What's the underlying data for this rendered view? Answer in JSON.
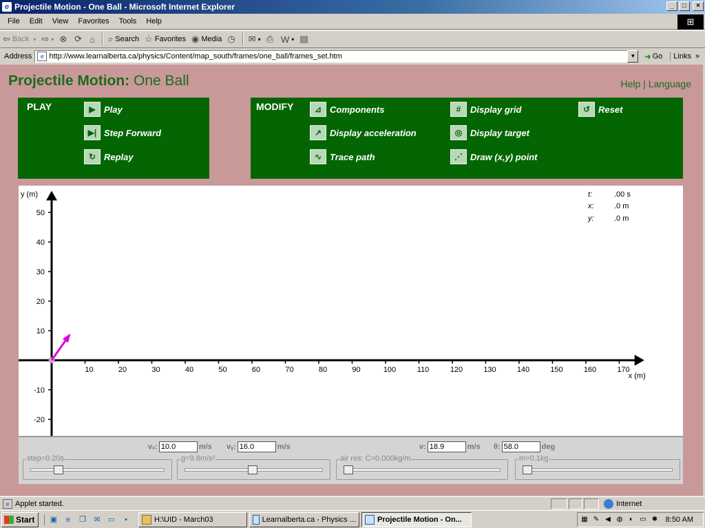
{
  "window": {
    "title": "Projectile Motion - One Ball - Microsoft Internet Explorer",
    "buttons": {
      "minimize": "_",
      "maximize": "□",
      "close": "×"
    }
  },
  "menu": [
    "File",
    "Edit",
    "View",
    "Favorites",
    "Tools",
    "Help"
  ],
  "toolbar": {
    "back": "Back",
    "search": "Search",
    "favorites": "Favorites",
    "media": "Media"
  },
  "address": {
    "label": "Address",
    "url": "http://www.learnalberta.ca/physics/Content/map_south/frames/one_ball/frames_set.htm",
    "go": "Go",
    "links": "Links"
  },
  "page": {
    "heading_bold": "Projectile Motion:",
    "heading_rest": " One Ball",
    "help": "Help",
    "separator": " | ",
    "language": "Language",
    "play_panel": {
      "title": "PLAY",
      "buttons": [
        {
          "label": "Play",
          "icon": "play-icon"
        },
        {
          "label": "Step Forward",
          "icon": "step-forward-icon"
        },
        {
          "label": "Replay",
          "icon": "replay-icon"
        }
      ]
    },
    "modify_panel": {
      "title": "MODIFY",
      "buttons": [
        {
          "label": "Components",
          "icon": "components-icon"
        },
        {
          "label": "Display acceleration",
          "icon": "acceleration-icon"
        },
        {
          "label": "Trace path",
          "icon": "trace-path-icon"
        },
        {
          "label": "Display grid",
          "icon": "grid-icon"
        },
        {
          "label": "Display target",
          "icon": "target-icon"
        },
        {
          "label": "Draw (x,y) point",
          "icon": "draw-point-icon"
        },
        {
          "label": "Reset",
          "icon": "reset-icon"
        }
      ]
    },
    "readout": [
      {
        "key": "t:",
        "value": ".00 s"
      },
      {
        "key": "x:",
        "value": ".0 m"
      },
      {
        "key": "y:",
        "value": ".0 m"
      }
    ],
    "controls": {
      "vx": {
        "label": "vₓ:",
        "value": "10.0",
        "unit": "m/s"
      },
      "vy": {
        "label": "vᵧ:",
        "value": "16.0",
        "unit": "m/s"
      },
      "v": {
        "label": "v:",
        "value": "18.9",
        "unit": "m/s"
      },
      "theta": {
        "label": "θ:",
        "value": "58.0",
        "unit": "deg"
      },
      "sliders": [
        {
          "title": "step=0.20s",
          "level": 0.19
        },
        {
          "title": "g=9.8m/s²",
          "level": 0.49
        },
        {
          "title": "air res: C=0.000kg/m",
          "level": 0.0
        },
        {
          "title": "m=0.1kg",
          "level": 0.0
        }
      ]
    }
  },
  "chart_data": {
    "type": "scatter",
    "xlabel": "x (m)",
    "ylabel": "y (m)",
    "xlim": [
      0,
      175
    ],
    "ylim": [
      -25,
      55
    ],
    "x_ticks": [
      10,
      20,
      30,
      40,
      50,
      60,
      70,
      80,
      90,
      100,
      110,
      120,
      130,
      140,
      150,
      160,
      170
    ],
    "y_ticks": [
      50,
      40,
      30,
      20,
      10,
      -10,
      -20
    ],
    "ball": {
      "x": 0,
      "y": 0
    },
    "velocity_vector": {
      "vx": 10.0,
      "vy": 16.0,
      "color": "#e000e0"
    }
  },
  "status": {
    "text": "Applet started.",
    "zone": "Internet"
  },
  "taskbar": {
    "start": "Start",
    "tasks": [
      {
        "label": "H:\\UID - March03",
        "active": false
      },
      {
        "label": "Learnalberta.ca - Physics ...",
        "active": false
      },
      {
        "label": "Projectile Motion - On...",
        "active": true
      }
    ],
    "clock": "8:50 AM"
  },
  "colors": {
    "page_bg": "#c99999",
    "panel_green": "#036603",
    "heading_green": "#1c6b1c",
    "vector": "#e000e0"
  }
}
